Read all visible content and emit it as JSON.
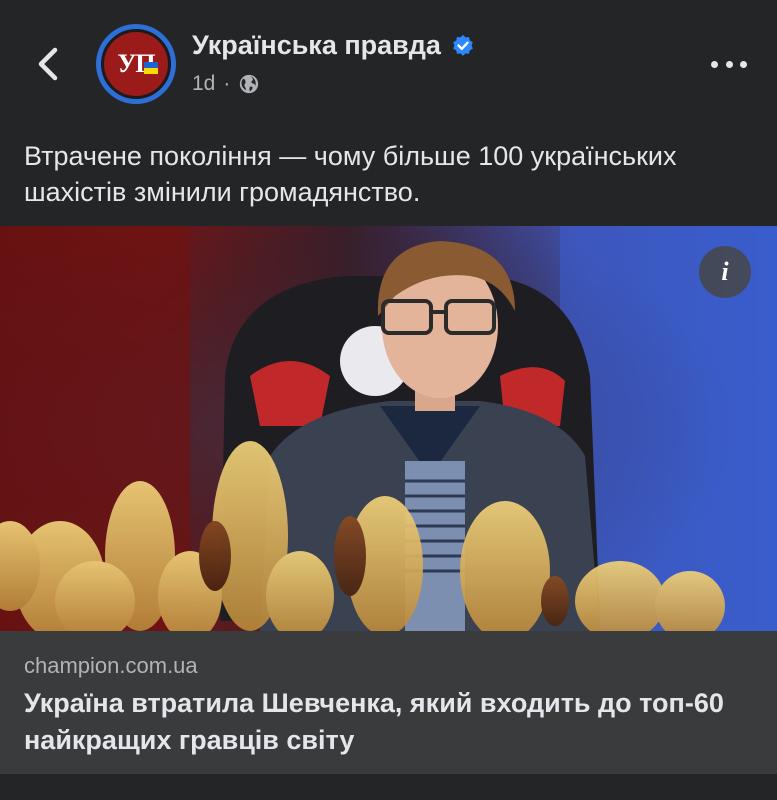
{
  "header": {
    "page_name": "Українська правда",
    "avatar_text": "УП",
    "time": "1d",
    "dot": "·",
    "icons": {
      "back": "chevron-left-icon",
      "verified": "verified-badge-icon",
      "audience": "globe-icon",
      "more": "more-horizontal-icon"
    },
    "colors": {
      "verified": "#2d88ff",
      "avatar_ring": "#2d6fd6",
      "avatar_bg": "#9b1b1b"
    }
  },
  "post": {
    "text": "Втрачене покоління — чому більше 100 українських шахістів змінили громадянство."
  },
  "image": {
    "info_label": "i"
  },
  "link": {
    "domain": "champion.com.ua",
    "title": "Україна втратила Шевченка, який входить до топ-60 найкращих гравців світу"
  }
}
